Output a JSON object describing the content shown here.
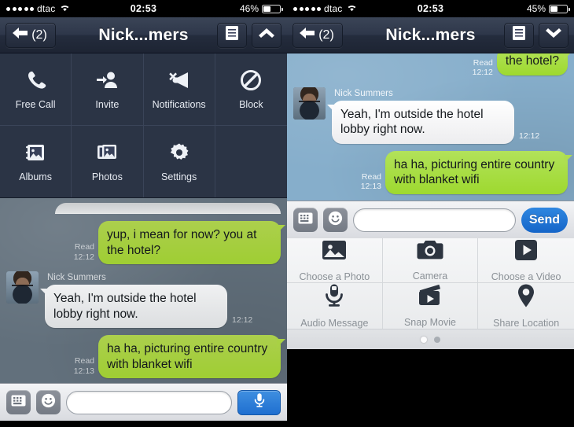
{
  "left": {
    "status_bar": {
      "signal_dots": 5,
      "carrier": "dtac",
      "wifi_icon": "wifi-icon",
      "time": "02:53",
      "battery_percent": "46%",
      "battery_level": 46
    },
    "nav": {
      "back_label": "(2)",
      "back_icon": "back-arrow-icon",
      "title": "Nick...mers",
      "list_icon": "list-menu-icon",
      "toggle_icon": "chevron-up-icon"
    },
    "menu": {
      "items": [
        {
          "label": "Free Call",
          "icon": "phone-icon"
        },
        {
          "label": "Invite",
          "icon": "invite-person-icon"
        },
        {
          "label": "Notifications",
          "icon": "notifications-muted-icon"
        },
        {
          "label": "Block",
          "icon": "block-icon"
        },
        {
          "label": "Albums",
          "icon": "albums-icon"
        },
        {
          "label": "Photos",
          "icon": "photos-icon"
        },
        {
          "label": "Settings",
          "icon": "gear-icon"
        }
      ]
    },
    "chat": {
      "messages": [
        {
          "type": "outgoing",
          "status": "Read",
          "time": "12:12",
          "text": "yup, i mean for now? you at the hotel?"
        },
        {
          "type": "incoming",
          "sender": "Nick Summers",
          "time": "12:12",
          "text": "Yeah, I'm outside the hotel lobby right now.",
          "avatar": "contact-avatar"
        },
        {
          "type": "outgoing",
          "status": "Read",
          "time": "12:13",
          "text": "ha ha, picturing entire country with blanket wifi"
        }
      ]
    },
    "input_bar": {
      "keyboard_icon": "keyboard-icon",
      "emoji_icon": "smiley-icon",
      "text_value": "",
      "placeholder": "",
      "action_icon": "microphone-icon"
    }
  },
  "right": {
    "status_bar": {
      "signal_dots": 5,
      "carrier": "dtac",
      "wifi_icon": "wifi-icon",
      "time": "02:53",
      "battery_percent": "45%",
      "battery_level": 45
    },
    "nav": {
      "back_label": "(2)",
      "back_icon": "back-arrow-icon",
      "title": "Nick...mers",
      "list_icon": "list-menu-icon",
      "toggle_icon": "chevron-down-icon"
    },
    "chat": {
      "messages": [
        {
          "type": "outgoing",
          "status": "Read",
          "time": "12:12",
          "text": "the hotel?"
        },
        {
          "type": "incoming",
          "sender": "Nick Summers",
          "time": "12:12",
          "text": "Yeah, I'm outside the hotel lobby right now.",
          "avatar": "contact-avatar"
        },
        {
          "type": "outgoing",
          "status": "Read",
          "time": "12:13",
          "text": "ha ha, picturing entire country with blanket wifi"
        }
      ]
    },
    "input_bar": {
      "keyboard_icon": "keyboard-icon",
      "emoji_icon": "smiley-icon",
      "text_value": "",
      "placeholder": "",
      "send_label": "Send"
    },
    "attachments": {
      "items": [
        {
          "label": "Choose a Photo",
          "icon": "photo-picture-icon"
        },
        {
          "label": "Camera",
          "icon": "camera-icon"
        },
        {
          "label": "Choose a Video",
          "icon": "video-play-icon"
        },
        {
          "label": "Audio Message",
          "icon": "microphone-icon"
        },
        {
          "label": "Snap Movie",
          "icon": "clapperboard-icon"
        },
        {
          "label": "Share Location",
          "icon": "map-pin-icon"
        }
      ],
      "pages": 2,
      "active_page": 1
    }
  },
  "colors": {
    "nav_dark": "#2b3445",
    "chat_bg_left": "#62707c",
    "chat_bg_right": "#86aecb",
    "bubble_green": "#a5d740",
    "bubble_grey": "#ededef",
    "accent_blue": "#1f6fd0"
  }
}
